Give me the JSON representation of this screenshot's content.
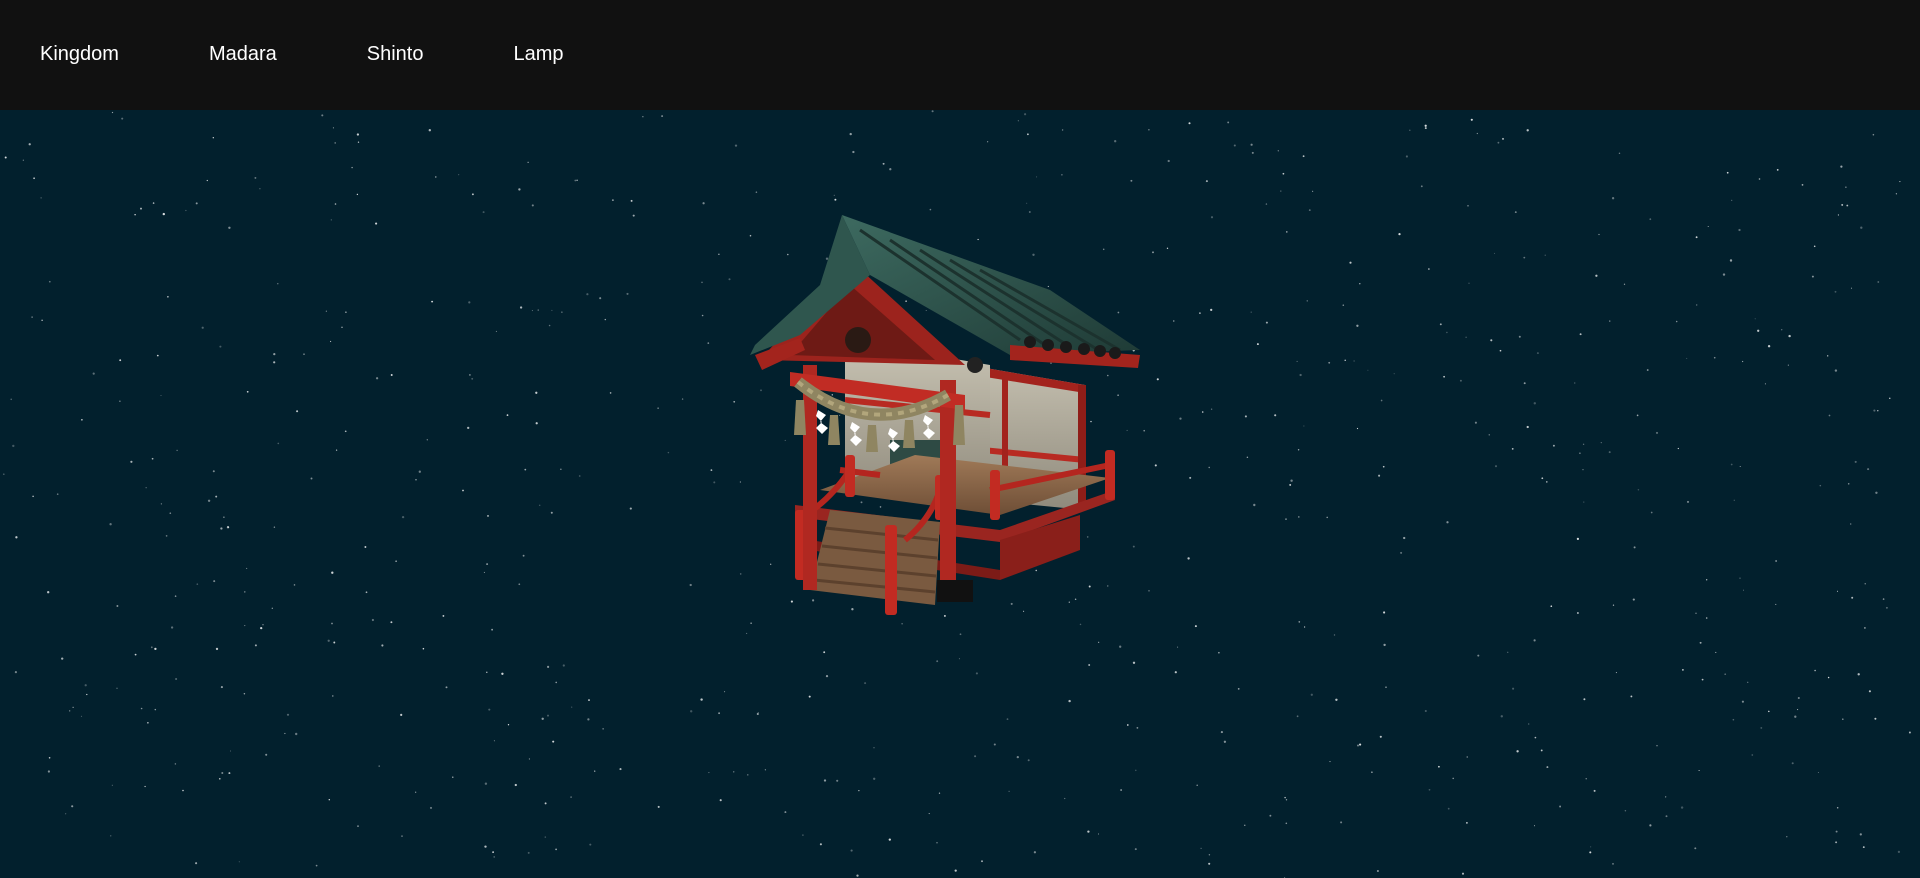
{
  "nav": {
    "items": [
      {
        "label": "Kingdom"
      },
      {
        "label": "Madara"
      },
      {
        "label": "Shinto"
      },
      {
        "label": "Lamp"
      }
    ]
  },
  "scene": {
    "background_color": "#02202d",
    "model": "shinto-shrine",
    "star_color": "#ffffff"
  }
}
